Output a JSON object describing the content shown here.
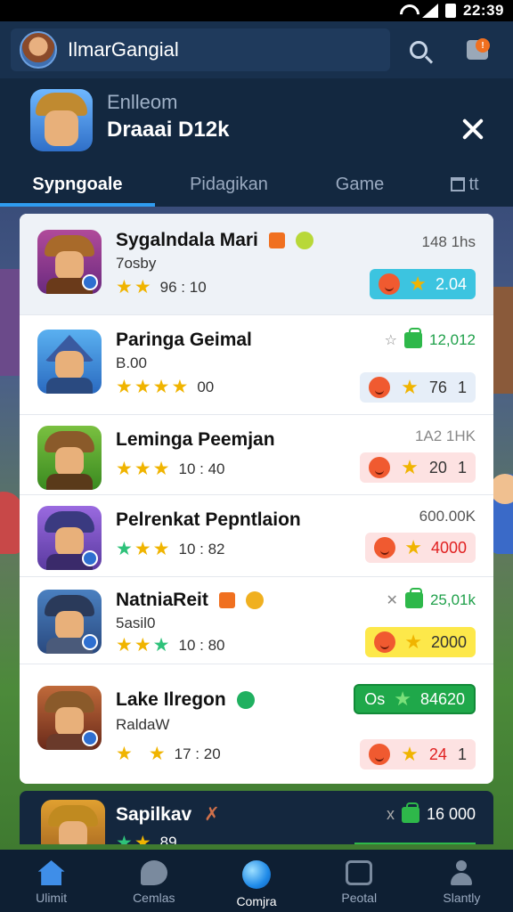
{
  "status_bar": {
    "time": "22:39"
  },
  "header": {
    "search_text": "IlmarGangial"
  },
  "profile": {
    "subtitle": "Enlleom",
    "name": "Draaai D12k"
  },
  "tabs": [
    {
      "label": "Sypngoale",
      "active": true
    },
    {
      "label": "Pidagikan",
      "active": false
    },
    {
      "label": "Game",
      "active": false
    },
    {
      "label": "tt",
      "active": false,
      "icon": "shop-icon"
    }
  ],
  "games": [
    {
      "title": "Sygalndala Mari",
      "sub": "7osby",
      "score": "96 : 10",
      "meta": "148 1hs",
      "pill": "2.04",
      "pill_style": "blue"
    },
    {
      "title": "Paringa Geimal",
      "sub": "B.00",
      "score": "00",
      "meta": "12,012",
      "meta_prefix": "x",
      "pill_a": "76",
      "pill_b": "1",
      "pill_style": "light"
    },
    {
      "title": "Leminga Peemjan",
      "sub": "",
      "score": "10 : 40",
      "meta": "1A2 1HK",
      "pill_a": "20",
      "pill_b": "1",
      "pill_style": "pink"
    },
    {
      "title": "Pelrenkat Pepntlaion",
      "sub": "",
      "score": "10 : 82",
      "meta": "600.00K",
      "pill": "4000",
      "pill_style": "pink"
    },
    {
      "title": "NatniaReit",
      "sub": "5asil0",
      "score": "10 : 80",
      "meta": "25,01k",
      "meta_prefix": "x",
      "pill": "2000",
      "pill_style": "yellow"
    },
    {
      "title": "Lake Ilregon",
      "sub": "RaldaW",
      "score": "17 : 20",
      "pill_green": "Os",
      "pill_green_value": "84620",
      "pill_a": "24",
      "pill_b": "1",
      "pill_style": "pink"
    }
  ],
  "peek": {
    "title": "Sapilkav",
    "meta_prefix": "x",
    "meta": "16 000",
    "score": "89"
  },
  "bottom_nav": [
    {
      "label": "Ulimit",
      "icon": "home-icon",
      "active": false
    },
    {
      "label": "Cemlas",
      "icon": "chat-icon",
      "active": false
    },
    {
      "label": "Comjra",
      "icon": "orb-icon",
      "active": true
    },
    {
      "label": "Peotal",
      "icon": "cup-icon",
      "active": false
    },
    {
      "label": "Slantly",
      "icon": "user-icon",
      "active": false
    }
  ],
  "colors": {
    "accent": "#2f9cf0",
    "header_bg": "#18304d",
    "panel_bg": "#ffffff",
    "green": "#2eb84a",
    "star": "#f0b400"
  }
}
